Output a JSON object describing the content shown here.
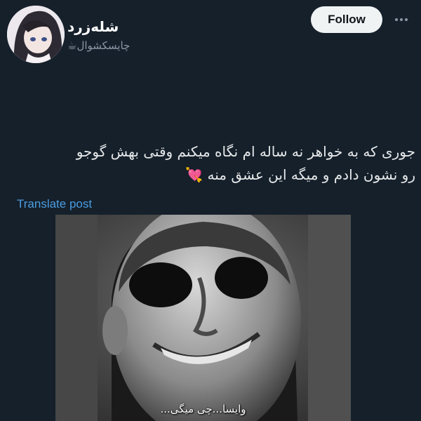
{
  "author": {
    "display_name": "شله‌زرد",
    "handle": "چایسکشوال☕"
  },
  "actions": {
    "follow_label": "Follow",
    "more_icon": "more-horizontal-icon"
  },
  "post": {
    "text_line1": "جوری که به خواهر نه ساله ام نگاه میکنم وقتی بهش گوجو",
    "text_line2": "رو نشون دادم و میگه این عشق منه 💘",
    "translate_label": "Translate post"
  },
  "media": {
    "caption": "وایسا...چی میگی..."
  },
  "colors": {
    "background": "#15202b",
    "link": "#4b9ce0",
    "follow_bg": "#eff3f4"
  }
}
